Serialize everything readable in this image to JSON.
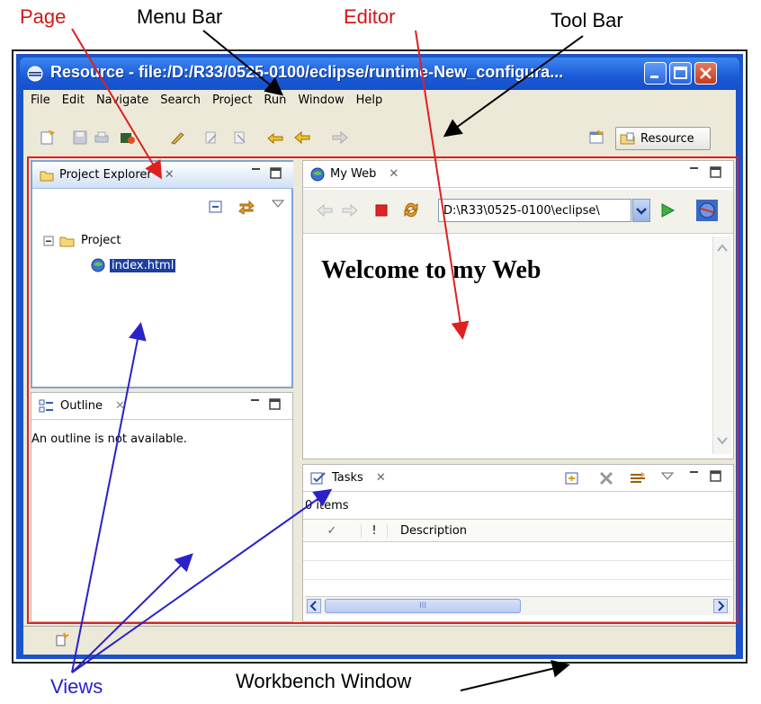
{
  "callouts": {
    "page": "Page",
    "menu_bar": "Menu Bar",
    "editor": "Editor",
    "tool_bar": "Tool Bar",
    "views": "Views",
    "workbench_window": "Workbench Window"
  },
  "window": {
    "title": "Resource - file:/D:/R33/0525-0100/eclipse/runtime-New_configura..."
  },
  "menubar": {
    "items": [
      "File",
      "Edit",
      "Navigate",
      "Search",
      "Project",
      "Run",
      "Window",
      "Help"
    ]
  },
  "toolbar": {
    "perspective_label": "Resource"
  },
  "project_explorer": {
    "tab_label": "Project Explorer",
    "tree": {
      "project": "Project",
      "file": "index.html"
    }
  },
  "outline": {
    "tab_label": "Outline",
    "message": "An outline is not available."
  },
  "editor": {
    "tab_label": "My Web",
    "url": "D:\\R33\\0525-0100\\eclipse\\",
    "content_heading": "Welcome to my Web"
  },
  "tasks": {
    "tab_label": "Tasks",
    "items_count": "0 items",
    "columns": [
      "✓",
      "!",
      "Description"
    ],
    "scroll_grip": "III"
  },
  "colors": {
    "callout_red": "#d01818",
    "callout_blue": "#2a22c8",
    "title_blue": "#1a5ad6",
    "page_outline": "#e02020",
    "selection": "#1d3fa0"
  }
}
